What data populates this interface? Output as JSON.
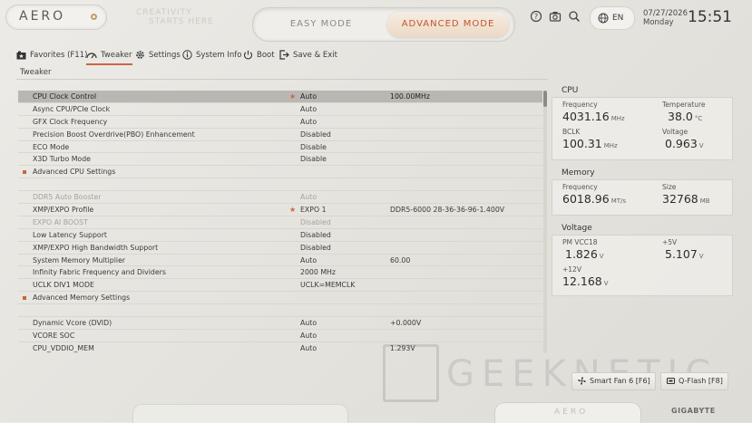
{
  "header": {
    "logo": "AERO",
    "slogan_line1": "CREATIVITY",
    "slogan_line2": "STARTS HERE",
    "mode_easy": "EASY MODE",
    "mode_advanced": "ADVANCED MODE",
    "language": "EN",
    "date": "07/27/2026",
    "weekday": "Monday",
    "time": "15:51"
  },
  "nav": {
    "favorites": "Favorites (F11)",
    "tweaker": "Tweaker",
    "settings": "Settings",
    "system_info": "System Info",
    "boot": "Boot",
    "save_exit": "Save & Exit"
  },
  "section_title": "Tweaker",
  "rows": [
    {
      "name": "CPU Clock Control",
      "value": "Auto",
      "ext": "100.00MHz",
      "star": true,
      "selected": true
    },
    {
      "name": "Async CPU/PCIe Clock",
      "value": "Auto",
      "ext": ""
    },
    {
      "name": "GFX Clock Frequency",
      "value": "Auto",
      "ext": ""
    },
    {
      "name": "Precision Boost Overdrive(PBO) Enhancement",
      "value": "Disabled",
      "ext": ""
    },
    {
      "name": "ECO Mode",
      "value": "Disable",
      "ext": ""
    },
    {
      "name": "X3D Turbo Mode",
      "value": "Disable",
      "ext": ""
    },
    {
      "name": "Advanced CPU Settings",
      "value": "",
      "ext": "",
      "bullet": true
    },
    {
      "name": "",
      "value": "",
      "ext": ""
    },
    {
      "name": "DDR5 Auto Booster",
      "value": "Auto",
      "ext": "",
      "dim": true
    },
    {
      "name": "XMP/EXPO Profile",
      "value": "EXPO 1",
      "ext": "DDR5-6000 28-36-36-96-1.400V",
      "star": true
    },
    {
      "name": "EXPO AI BOOST",
      "value": "Disabled",
      "ext": "",
      "dim": true
    },
    {
      "name": "Low Latency Support",
      "value": "Disabled",
      "ext": ""
    },
    {
      "name": "XMP/EXPO High Bandwidth Support",
      "value": "Disabled",
      "ext": ""
    },
    {
      "name": "System Memory Multiplier",
      "value": "Auto",
      "ext": "60.00"
    },
    {
      "name": "Infinity Fabric Frequency and Dividers",
      "value": "2000 MHz",
      "ext": ""
    },
    {
      "name": "UCLK DIV1 MODE",
      "value": "UCLK=MEMCLK",
      "ext": ""
    },
    {
      "name": "Advanced Memory Settings",
      "value": "",
      "ext": "",
      "bullet": true
    },
    {
      "name": "",
      "value": "",
      "ext": ""
    },
    {
      "name": "Dynamic Vcore (DVID)",
      "value": "Auto",
      "ext": "+0.000V"
    },
    {
      "name": "VCORE SOC",
      "value": "Auto",
      "ext": ""
    },
    {
      "name": "CPU_VDDIO_MEM",
      "value": "Auto",
      "ext": "1.293V"
    }
  ],
  "cpu": {
    "title": "CPU",
    "frequency_label": "Frequency",
    "frequency": "4031.16",
    "frequency_unit": "MHz",
    "temperature_label": "Temperature",
    "temperature": "38.0",
    "temperature_unit": "°C",
    "bclk_label": "BCLK",
    "bclk": "100.31",
    "bclk_unit": "MHz",
    "voltage_label": "Voltage",
    "voltage": "0.963",
    "voltage_unit": "V"
  },
  "memory": {
    "title": "Memory",
    "frequency_label": "Frequency",
    "frequency": "6018.96",
    "frequency_unit": "MT/s",
    "size_label": "Size",
    "size": "32768",
    "size_unit": "MB"
  },
  "voltage": {
    "title": "Voltage",
    "pm_vcc18_label": "PM VCC18",
    "pm_vcc18": "1.826",
    "pm_vcc18_unit": "V",
    "p5v_label": "+5V",
    "p5v": "5.107",
    "p5v_unit": "V",
    "p12v_label": "+12V",
    "p12v": "12.168",
    "p12v_unit": "V"
  },
  "bottom": {
    "smart_fan": "Smart Fan 6 [F6]",
    "qflash": "Q-Flash [F8]",
    "aero_tag": "AERO",
    "brand": "GIGABYTE",
    "watermark": "GEEKNETIC"
  },
  "colors": {
    "accent": "#c9653f",
    "background": "#e6e4df",
    "selected_row": "#b9b7b2"
  }
}
